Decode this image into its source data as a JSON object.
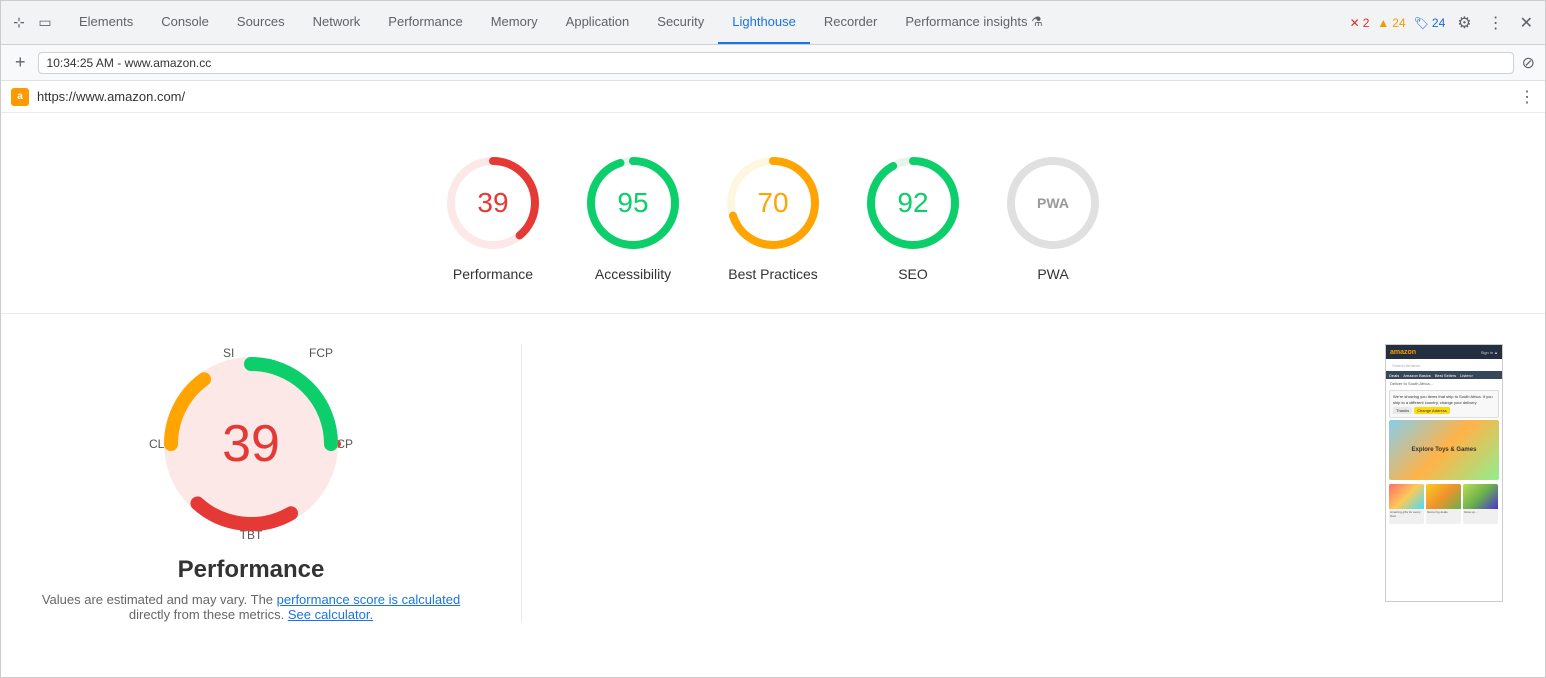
{
  "toolbar": {
    "tabs": [
      {
        "id": "elements",
        "label": "Elements",
        "active": false
      },
      {
        "id": "console",
        "label": "Console",
        "active": false
      },
      {
        "id": "sources",
        "label": "Sources",
        "active": false
      },
      {
        "id": "network",
        "label": "Network",
        "active": false
      },
      {
        "id": "performance",
        "label": "Performance",
        "active": false
      },
      {
        "id": "memory",
        "label": "Memory",
        "active": false
      },
      {
        "id": "application",
        "label": "Application",
        "active": false
      },
      {
        "id": "security",
        "label": "Security",
        "active": false
      },
      {
        "id": "lighthouse",
        "label": "Lighthouse",
        "active": true
      },
      {
        "id": "recorder",
        "label": "Recorder",
        "active": false
      },
      {
        "id": "performance-insights",
        "label": "Performance insights ⚗",
        "active": false
      }
    ],
    "errors": {
      "count": "2",
      "icon": "✕"
    },
    "warnings": {
      "count": "24",
      "icon": "▲"
    },
    "info": {
      "count": "24",
      "icon": "🏷"
    }
  },
  "address_bar": {
    "time_url": "10:34:25 AM - www.amazon.cc",
    "new_tab": "+",
    "reload": "⊘"
  },
  "url_bar": {
    "url": "https://www.amazon.com/",
    "more": "⋮"
  },
  "scores": [
    {
      "id": "performance",
      "value": "39",
      "label": "Performance",
      "color": "#e53935",
      "bg_color": "#fce8e6",
      "track_color": "#fce8e6",
      "percent": 39
    },
    {
      "id": "accessibility",
      "value": "95",
      "label": "Accessibility",
      "color": "#0cce6b",
      "bg_color": "#e6f4ea",
      "track_color": "#e6f4ea",
      "percent": 95
    },
    {
      "id": "best-practices",
      "value": "70",
      "label": "Best Practices",
      "color": "#ffa400",
      "bg_color": "#fef7e0",
      "track_color": "#fef7e0",
      "percent": 70
    },
    {
      "id": "seo",
      "value": "92",
      "label": "SEO",
      "color": "#0cce6b",
      "bg_color": "#e6f4ea",
      "track_color": "#e6f4ea",
      "percent": 92
    },
    {
      "id": "pwa",
      "value": "—",
      "label": "PWA",
      "color": "#999",
      "bg_color": "#f1f3f4",
      "track_color": "#e0e0e0",
      "percent": 0
    }
  ],
  "performance_detail": {
    "score": "39",
    "title": "Performance",
    "metrics": {
      "si": "SI",
      "fcp": "FCP",
      "lcp": "LCP",
      "tbt": "TBT",
      "cls": "CLS"
    },
    "note_prefix": "Values are estimated and may vary. The ",
    "note_link1": "performance score is calculated",
    "note_link1_href": "#",
    "note_between": " directly from these metrics. ",
    "note_link2": "See calculator.",
    "note_link2_href": "#"
  },
  "screenshot": {
    "alt": "Amazon website screenshot"
  }
}
